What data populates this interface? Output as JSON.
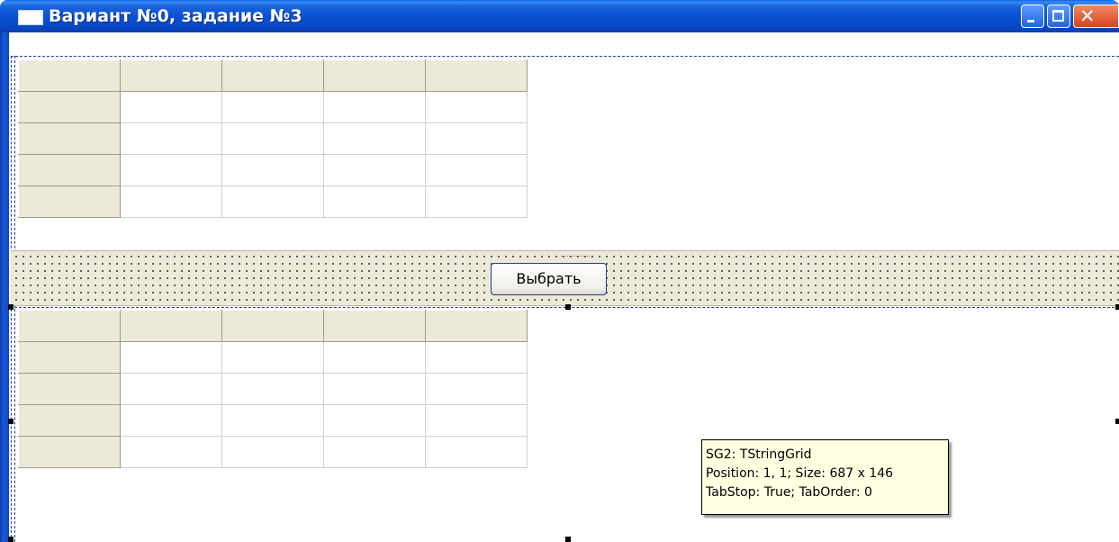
{
  "window": {
    "title": "Вариант №0, задание №3"
  },
  "grid1": {
    "rows": 5,
    "cols": 5
  },
  "panel": {
    "button_label": "Выбрать"
  },
  "grid2": {
    "rows": 5,
    "cols": 5
  },
  "tooltip": {
    "line1": "SG2: TStringGrid",
    "line2": "Position: 1, 1; Size: 687 x 146",
    "line3": "TabStop: True; TabOrder: 0"
  },
  "colors": {
    "titlebar": "#0a52d6",
    "grid_fixed": "#ece9d8",
    "tooltip_bg": "#ffffe1"
  },
  "icons": [
    "window-icon",
    "minimize-icon",
    "maximize-icon",
    "close-icon"
  ]
}
